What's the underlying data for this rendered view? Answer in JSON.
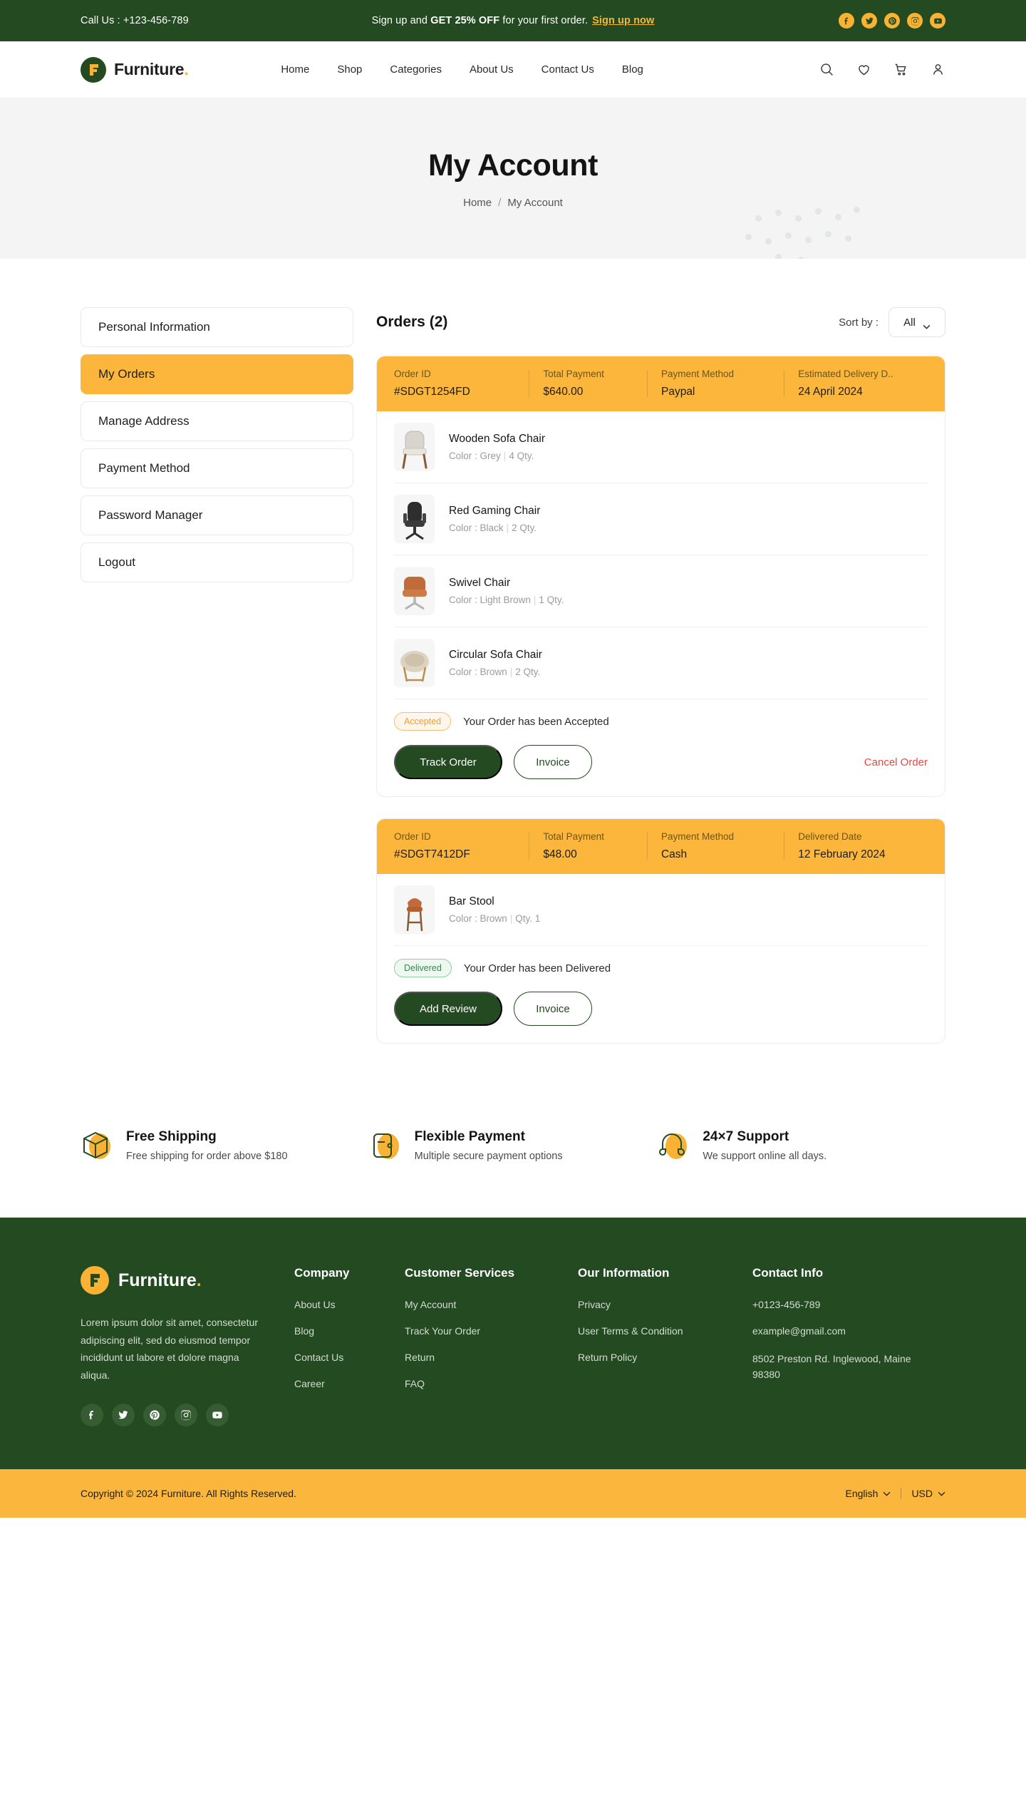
{
  "topbar": {
    "call_label": "Call Us :",
    "phone": "+123-456-789",
    "promo_pre": "Sign up and ",
    "promo_bold": "GET 25% OFF",
    "promo_post": " for your first order.",
    "signup_link": "Sign up now",
    "social": [
      "facebook-icon",
      "twitter-icon",
      "pinterest-icon",
      "instagram-icon",
      "youtube-icon"
    ]
  },
  "header": {
    "brand_name": "Furniture",
    "brand_dot": ".",
    "nav": [
      {
        "label": "Home"
      },
      {
        "label": "Shop"
      },
      {
        "label": "Categories"
      },
      {
        "label": "About Us"
      },
      {
        "label": "Contact Us"
      },
      {
        "label": "Blog"
      }
    ],
    "icons": [
      "search-icon",
      "wishlist-heart-icon",
      "cart-icon",
      "user-account-icon"
    ]
  },
  "hero": {
    "title": "My Account",
    "breadcrumb_home": "Home",
    "breadcrumb_sep": "/",
    "breadcrumb_current": "My Account"
  },
  "sidebar": {
    "items": [
      {
        "label": "Personal Information",
        "active": false
      },
      {
        "label": "My Orders",
        "active": true
      },
      {
        "label": "Manage Address",
        "active": false
      },
      {
        "label": "Payment Method",
        "active": false
      },
      {
        "label": "Password Manager",
        "active": false
      },
      {
        "label": "Logout",
        "active": false
      }
    ]
  },
  "orders_section": {
    "title": "Orders (2)",
    "sort_label": "Sort by :",
    "sort_value": "All",
    "orders": [
      {
        "head": {
          "order_id_label": "Order ID",
          "order_id_value": "#SDGT1254FD",
          "total_label": "Total Payment",
          "total_value": "$640.00",
          "method_label": "Payment Method",
          "method_value": "Paypal",
          "date_label": "Estimated Delivery D..",
          "date_value": "24 April 2024"
        },
        "products": [
          {
            "name": "Wooden Sofa Chair",
            "color_label": "Color :",
            "color": "Grey",
            "qty": "4 Qty.",
            "thumb": "wooden-sofa-chair-thumb"
          },
          {
            "name": "Red Gaming Chair",
            "color_label": "Color :",
            "color": "Black",
            "qty": "2 Qty.",
            "thumb": "red-gaming-chair-thumb"
          },
          {
            "name": "Swivel Chair",
            "color_label": "Color :",
            "color": "Light Brown",
            "qty": "1 Qty.",
            "thumb": "swivel-chair-thumb"
          },
          {
            "name": "Circular Sofa Chair",
            "color_label": "Color : ",
            "color": "Brown",
            "qty": "2 Qty.",
            "thumb": "circular-sofa-chair-thumb"
          }
        ],
        "status_badge": "Accepted",
        "status_text": "Your Order has been Accepted",
        "primary_button": "Track Order",
        "secondary_button": "Invoice",
        "cancel_button": "Cancel Order"
      },
      {
        "head": {
          "order_id_label": "Order ID",
          "order_id_value": "#SDGT7412DF",
          "total_label": "Total Payment",
          "total_value": "$48.00",
          "method_label": "Payment Method",
          "method_value": "Cash",
          "date_label": "Delivered Date",
          "date_value": "12 February 2024"
        },
        "products": [
          {
            "name": "Bar Stool",
            "color_label": "Color : ",
            "color": "Brown",
            "qty": "Qty. 1",
            "thumb": "bar-stool-thumb"
          }
        ],
        "status_badge": "Delivered",
        "status_text": "Your Order has been Delivered",
        "primary_button": "Add Review",
        "secondary_button": "Invoice",
        "cancel_button": ""
      }
    ]
  },
  "features": [
    {
      "icon": "shipping-box-icon",
      "title": "Free Shipping",
      "sub": "Free shipping for order above $180"
    },
    {
      "icon": "payment-card-icon",
      "title": "Flexible Payment",
      "sub": "Multiple secure payment options"
    },
    {
      "icon": "headset-support-icon",
      "title": "24×7 Support",
      "sub": "We support online all days."
    }
  ],
  "footer": {
    "brand_name": "Furniture",
    "brand_dot": ".",
    "description": "Lorem ipsum dolor sit amet, consectetur adipiscing elit, sed do eiusmod tempor incididunt ut labore et dolore magna aliqua.",
    "social": [
      "facebook-icon",
      "twitter-icon",
      "pinterest-icon",
      "instagram-icon",
      "youtube-icon"
    ],
    "columns": [
      {
        "heading": "Company",
        "links": [
          "About Us",
          "Blog",
          "Contact Us",
          "Career"
        ]
      },
      {
        "heading": "Customer Services",
        "links": [
          "My Account",
          "Track Your Order",
          "Return",
          "FAQ"
        ]
      },
      {
        "heading": "Our Information",
        "links": [
          "Privacy",
          "User Terms & Condition",
          "Return Policy"
        ]
      }
    ],
    "contact": {
      "heading": "Contact Info",
      "phone": "+0123-456-789",
      "email": "example@gmail.com",
      "address": "8502 Preston Rd. Inglewood, Maine 98380"
    }
  },
  "copyright": {
    "text": "Copyright © 2024 Furniture. All Rights Reserved.",
    "language": "English",
    "currency": "USD"
  },
  "colors": {
    "green": "#234a20",
    "yellow": "#fcb63c",
    "red": "#f0453f",
    "hero_bg": "#f4f4f4"
  }
}
